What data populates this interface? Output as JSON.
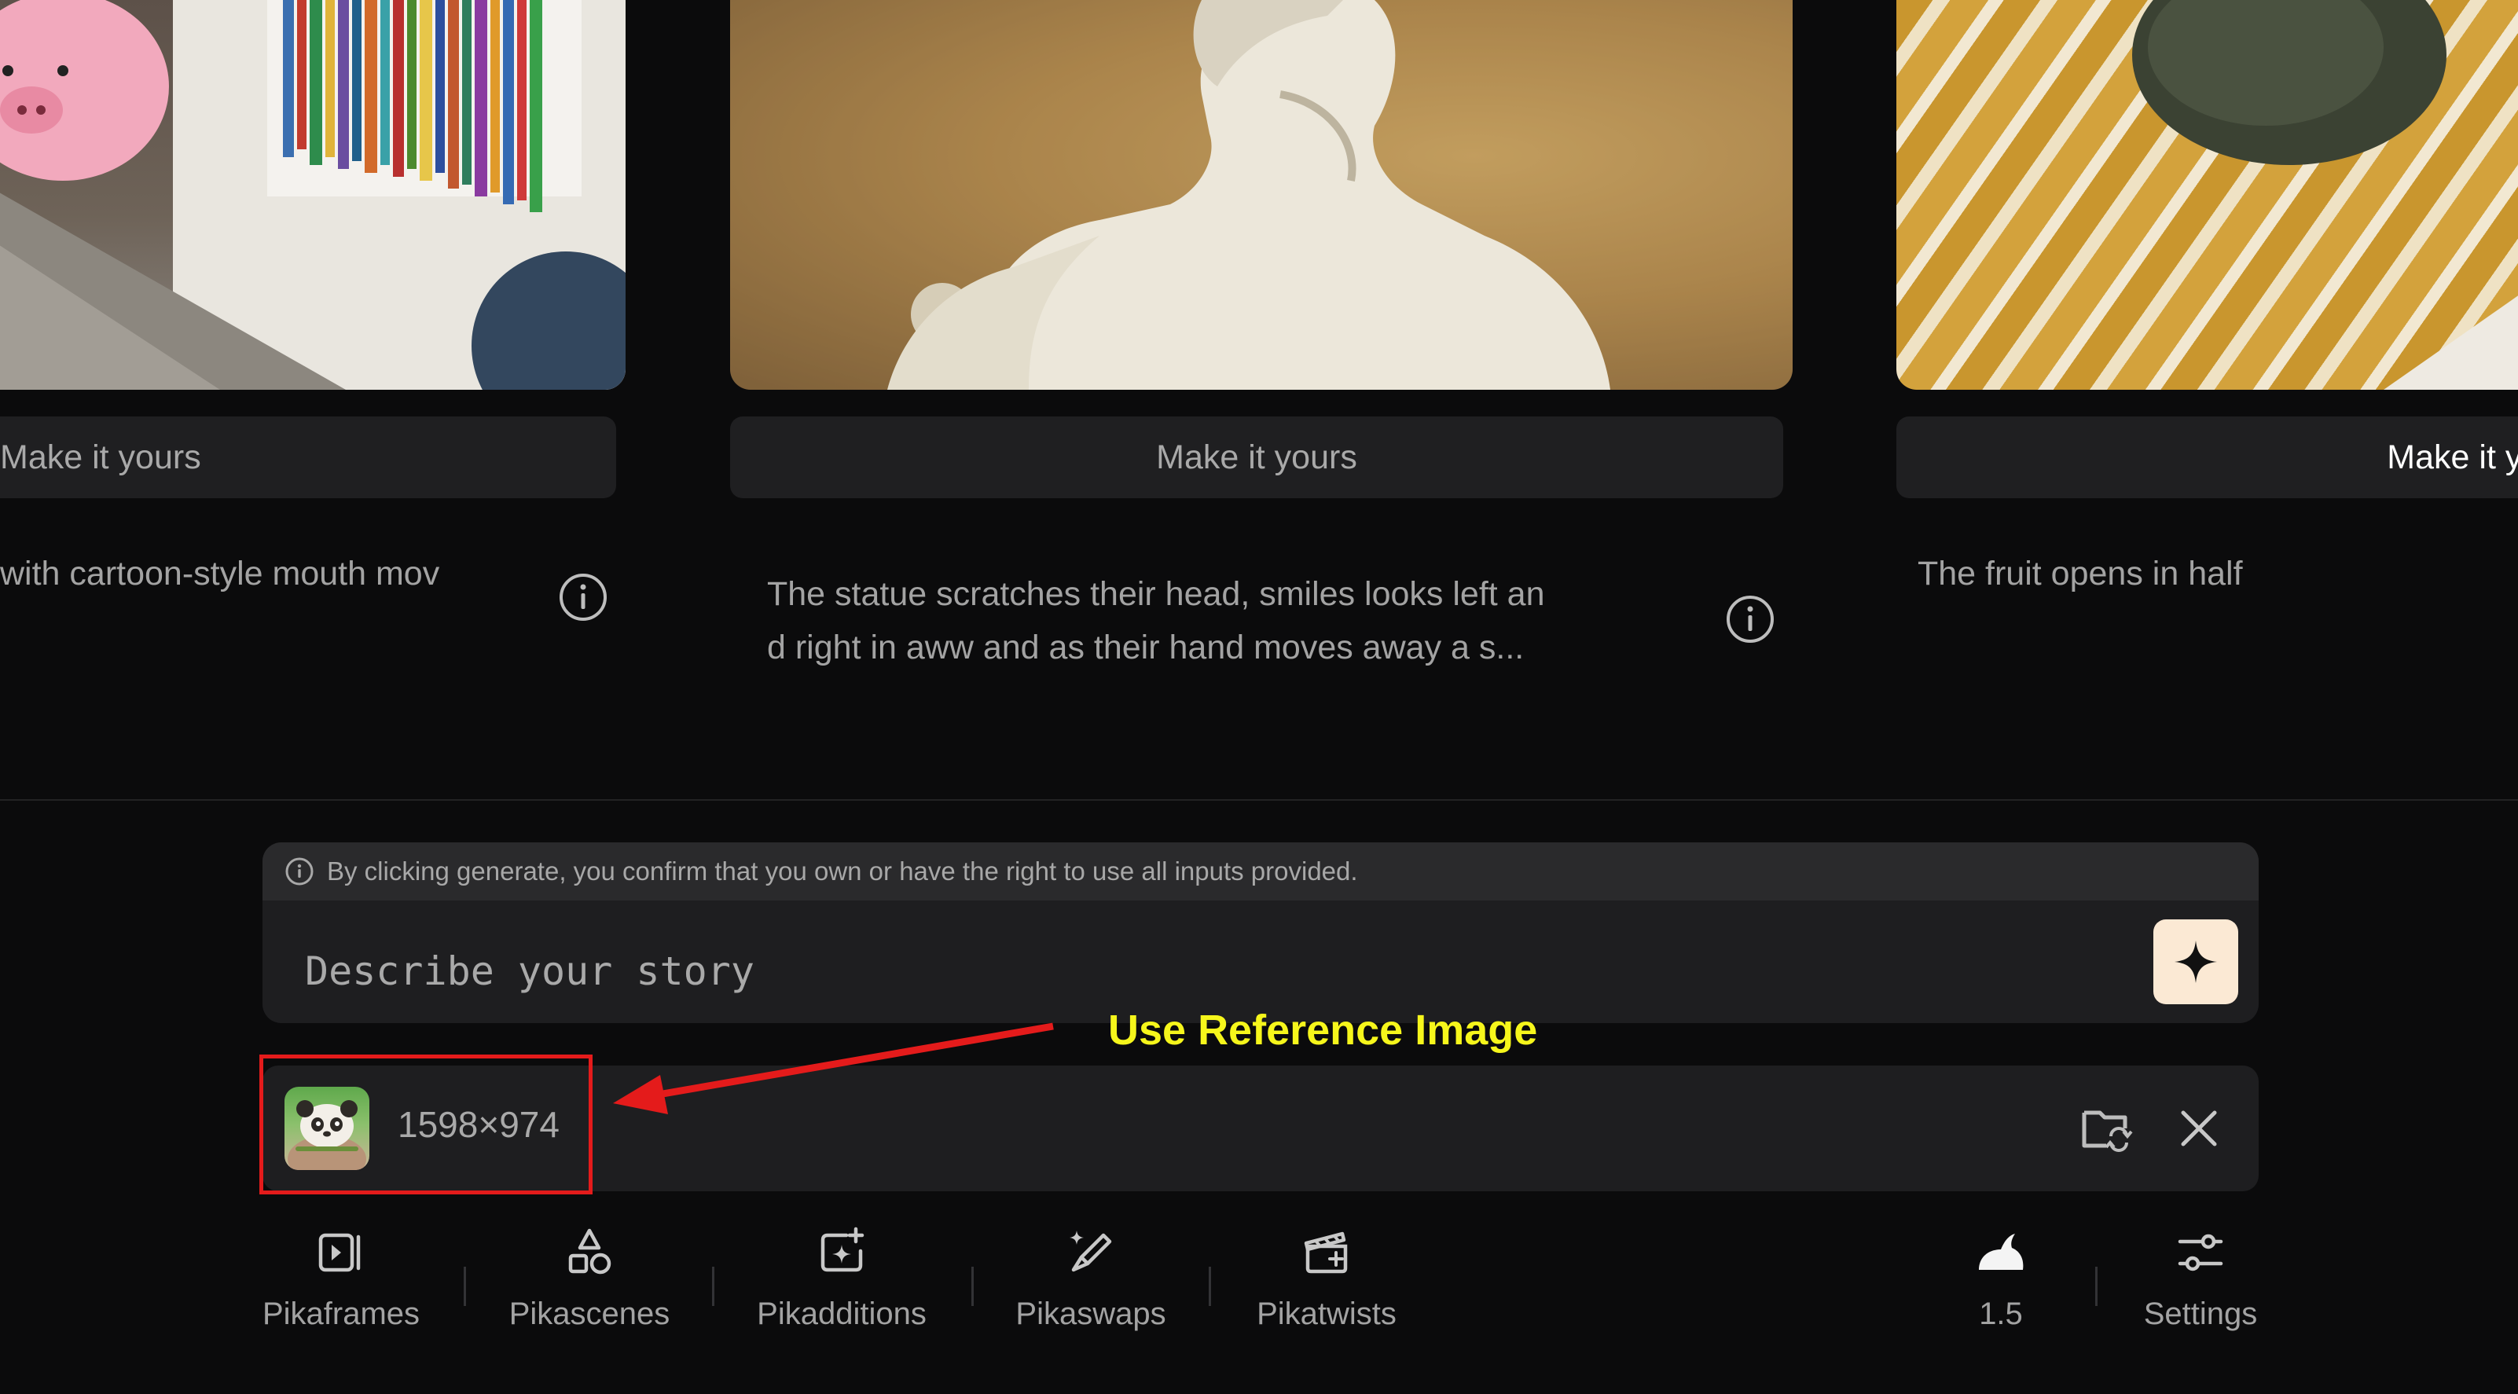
{
  "gallery": {
    "cards": [
      {
        "cta_label": "Make it yours",
        "description_lines": [
          "with cartoon-style mouth mov"
        ]
      },
      {
        "cta_label": "Make it yours",
        "description_lines": [
          "The statue scratches their head, smiles looks left an",
          "d right in aww and as their hand moves away a s..."
        ]
      },
      {
        "cta_label": "Make it yours",
        "description_lines": [
          "The fruit opens in half"
        ]
      }
    ]
  },
  "prompt": {
    "disclaimer": "By clicking generate, you confirm that you own or have the right to use all inputs provided.",
    "placeholder": "Describe your story"
  },
  "reference_image": {
    "dimensions": "1598×974"
  },
  "annotation": {
    "text": "Use Reference Image",
    "color": "#f6f61b",
    "box_color": "#e41b1b"
  },
  "toolbar": {
    "tools": [
      {
        "label": "Pikaframes",
        "icon": "frames-icon"
      },
      {
        "label": "Pikascenes",
        "icon": "shapes-icon"
      },
      {
        "label": "Pikadditions",
        "icon": "add-sparkle-icon"
      },
      {
        "label": "Pikaswaps",
        "icon": "brush-sparkle-icon"
      },
      {
        "label": "Pikatwists",
        "icon": "clapperboard-icon"
      }
    ],
    "model_version": "1.5",
    "settings_label": "Settings"
  },
  "colors": {
    "background": "#0b0b0c",
    "panel": "#1e1e20",
    "generate_button": "#fbe9d4"
  }
}
